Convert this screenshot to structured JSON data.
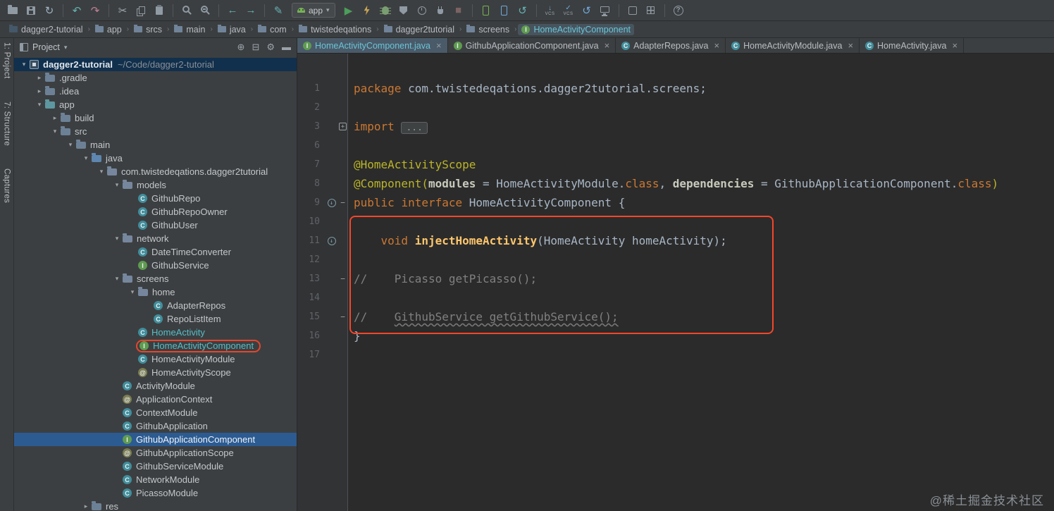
{
  "icons": {
    "chevron_down": "▾",
    "chevron_right": "▸",
    "chevron_sep": "›",
    "close": "×",
    "plus": "+",
    "minus": "−",
    "arrow_down": "↓",
    "check": "✓",
    "vcs_label": "VCS",
    "class_letter": "C",
    "interface_letter": "I",
    "annotation_char": "@",
    "help": "?"
  },
  "colors": {
    "highlight_red": "#f5462a",
    "selection_blue": "#2c5b92",
    "accent_teal": "#57bdc6",
    "keyword_orange": "#cc7832",
    "annotation_yellow": "#bbb529",
    "comment_gray": "#808080",
    "editor_bg": "#2b2b2b",
    "panel_bg": "#3c3f41"
  },
  "toolbar": {
    "items": [
      {
        "name": "open-project-icon",
        "css": "i-folder"
      },
      {
        "name": "save-all-icon",
        "css": "i-save"
      },
      {
        "name": "sync-icon",
        "glyph": "↻",
        "color": "#9fb3c4"
      },
      {
        "sep": true
      },
      {
        "name": "undo-icon",
        "glyph": "↶",
        "color": "#64b1b4"
      },
      {
        "name": "redo-icon",
        "glyph": "↷",
        "color": "#bd8193"
      },
      {
        "sep": true
      },
      {
        "name": "cut-icon",
        "glyph": "✂",
        "color": "#9fa9b1"
      },
      {
        "name": "copy-icon",
        "css": "i-copy"
      },
      {
        "name": "paste-icon",
        "css": "i-paste"
      },
      {
        "sep": true
      },
      {
        "name": "find-icon",
        "css": "i-search"
      },
      {
        "name": "replace-icon",
        "css": "i-replace"
      },
      {
        "sep": true
      },
      {
        "name": "back-icon",
        "glyph": "←",
        "color": "#64b1b4"
      },
      {
        "name": "forward-icon",
        "glyph": "→",
        "color": "#64b1b4"
      },
      {
        "sep": true
      },
      {
        "name": "edit-pencil-icon",
        "glyph": "✎",
        "color": "#64b1b4"
      },
      {
        "runconfig": true,
        "name": "run-config-select",
        "label": "app"
      },
      {
        "name": "run-icon",
        "glyph": "▶",
        "color": "#4c9e5a"
      },
      {
        "name": "apply-changes-icon",
        "css": "i-bolt"
      },
      {
        "name": "debug-icon",
        "css": "i-bug"
      },
      {
        "name": "coverage-icon",
        "css": "i-shield"
      },
      {
        "name": "profile-icon",
        "css": "i-clock"
      },
      {
        "name": "attach-debugger-icon",
        "css": "i-plug"
      },
      {
        "name": "stop-icon",
        "glyph": "■",
        "color": "#7b6263"
      },
      {
        "sep": true
      },
      {
        "name": "android-device-monitor-icon",
        "css": "i-phone"
      },
      {
        "name": "avd-manager-icon",
        "css": "i-phone-blue"
      },
      {
        "name": "gradle-sync-icon",
        "glyph": "↺",
        "color": "#64b1b4"
      },
      {
        "sep": true
      },
      {
        "name": "vcs-update-icon",
        "vcs": "down"
      },
      {
        "name": "vcs-commit-icon",
        "vcs": "check"
      },
      {
        "name": "revert-icon",
        "glyph": "↺",
        "color": "#6fa8dc"
      },
      {
        "name": "console-icon",
        "css": "i-monitor"
      },
      {
        "sep": true
      },
      {
        "name": "sdk-manager-icon",
        "css": "i-download"
      },
      {
        "name": "layout-inspector-icon",
        "css": "i-grid"
      },
      {
        "sep": true
      },
      {
        "name": "help-icon",
        "css": "i-help",
        "glyph": "?"
      }
    ]
  },
  "navbar": {
    "items": [
      {
        "ic": "project",
        "label": "dagger2-tutorial"
      },
      {
        "ic": "folder",
        "label": "app"
      },
      {
        "ic": "folder",
        "label": "srcs"
      },
      {
        "ic": "folder",
        "label": "main"
      },
      {
        "ic": "folder",
        "label": "java"
      },
      {
        "ic": "folder",
        "label": "com"
      },
      {
        "ic": "folder",
        "label": "twistedeqations"
      },
      {
        "ic": "folder",
        "label": "dagger2tutorial"
      },
      {
        "ic": "folder",
        "label": "screens"
      },
      {
        "ic": "interface",
        "label": "HomeActivityComponent",
        "active": true
      }
    ]
  },
  "left_stripe": {
    "items": [
      "1: Project",
      "7: Structure",
      "Captures"
    ]
  },
  "project_panel": {
    "title": "Project",
    "header_icons": [
      {
        "name": "scroll-to-source-icon",
        "glyph": "⊕"
      },
      {
        "name": "collapse-all-icon",
        "glyph": "⊟"
      },
      {
        "name": "settings-gear-icon",
        "glyph": "⚙"
      },
      {
        "name": "hide-panel-icon",
        "glyph": "▬"
      }
    ]
  },
  "tree": {
    "rows": [
      {
        "lv": 0,
        "ar": "v",
        "ic": "project",
        "label": "dagger2-tutorial",
        "path": "~/Code/dagger2-tutorial",
        "cls": "proj"
      },
      {
        "lv": 1,
        "ar": ">",
        "ic": "folder",
        "label": ".gradle"
      },
      {
        "lv": 1,
        "ar": ">",
        "ic": "folder",
        "label": ".idea"
      },
      {
        "lv": 1,
        "ar": "v",
        "ic": "module",
        "label": "app"
      },
      {
        "lv": 2,
        "ar": ">",
        "ic": "folder",
        "label": "build"
      },
      {
        "lv": 2,
        "ar": "v",
        "ic": "folder",
        "label": "src"
      },
      {
        "lv": 3,
        "ar": "v",
        "ic": "folder",
        "label": "main"
      },
      {
        "lv": 4,
        "ar": "v",
        "ic": "java",
        "label": "java"
      },
      {
        "lv": 5,
        "ar": "v",
        "ic": "package",
        "label": "com.twistedeqations.dagger2tutorial"
      },
      {
        "lv": 6,
        "ar": "v",
        "ic": "package",
        "label": "models"
      },
      {
        "lv": 7,
        "ic": "class",
        "label": "GithubRepo"
      },
      {
        "lv": 7,
        "ic": "class",
        "label": "GithubRepoOwner"
      },
      {
        "lv": 7,
        "ic": "class",
        "label": "GithubUser"
      },
      {
        "lv": 6,
        "ar": "v",
        "ic": "package",
        "label": "network"
      },
      {
        "lv": 7,
        "ic": "class",
        "label": "DateTimeConverter"
      },
      {
        "lv": 7,
        "ic": "interface",
        "label": "GithubService"
      },
      {
        "lv": 6,
        "ar": "v",
        "ic": "package",
        "label": "screens"
      },
      {
        "lv": 7,
        "ar": "v",
        "ic": "package",
        "label": "home"
      },
      {
        "lv": 8,
        "ic": "class",
        "label": "AdapterRepos"
      },
      {
        "lv": 8,
        "ic": "class",
        "label": "RepoListItem"
      },
      {
        "lv": 7,
        "ic": "class",
        "label": "HomeActivity",
        "accent": true
      },
      {
        "lv": 7,
        "ic": "interface",
        "label": "HomeActivityComponent",
        "accent": true,
        "outlined": true
      },
      {
        "lv": 7,
        "ic": "class",
        "label": "HomeActivityModule"
      },
      {
        "lv": 7,
        "ic": "annotation",
        "label": "HomeActivityScope"
      },
      {
        "lv": 6,
        "ic": "class",
        "label": "ActivityModule"
      },
      {
        "lv": 6,
        "ic": "annotation",
        "label": "ApplicationContext"
      },
      {
        "lv": 6,
        "ic": "class",
        "label": "ContextModule"
      },
      {
        "lv": 6,
        "ic": "class",
        "label": "GithubApplication"
      },
      {
        "lv": 6,
        "ic": "interface",
        "label": "GithubApplicationComponent",
        "selected": true
      },
      {
        "lv": 6,
        "ic": "annotation",
        "label": "GithubApplicationScope"
      },
      {
        "lv": 6,
        "ic": "class",
        "label": "GithubServiceModule"
      },
      {
        "lv": 6,
        "ic": "class",
        "label": "NetworkModule"
      },
      {
        "lv": 6,
        "ic": "class",
        "label": "PicassoModule"
      },
      {
        "lv": 4,
        "ar": ">",
        "ic": "folder",
        "label": "res"
      }
    ]
  },
  "editor": {
    "tabs": [
      {
        "ic": "interface",
        "label": "HomeActivityComponent.java",
        "active": true
      },
      {
        "ic": "interface",
        "label": "GithubApplicationComponent.java"
      },
      {
        "ic": "class",
        "label": "AdapterRepos.java"
      },
      {
        "ic": "class",
        "label": "HomeActivityModule.java"
      },
      {
        "ic": "class",
        "label": "HomeActivity.java"
      }
    ],
    "code": {
      "lines": [
        {
          "n": "1",
          "tk": [
            [
              "kw",
              "package"
            ],
            [
              "pl",
              " com.twistedeqations.dagger2tutorial.screens;"
            ]
          ]
        },
        {
          "n": "2",
          "tk": []
        },
        {
          "n": "3",
          "fold": "plus",
          "tk": [
            [
              "kw",
              "import"
            ],
            [
              "pl",
              " "
            ],
            [
              "chip",
              "..."
            ]
          ]
        },
        {
          "n": "6",
          "tk": []
        },
        {
          "n": "7",
          "tk": [
            [
              "ann",
              "@HomeActivityScope"
            ]
          ]
        },
        {
          "n": "8",
          "tk": [
            [
              "ann",
              "@Component("
            ],
            [
              "attr",
              "modules"
            ],
            [
              "pl",
              " = HomeActivityModule."
            ],
            [
              "kw",
              "class"
            ],
            [
              "pl",
              ", "
            ],
            [
              "attr",
              "dependencies"
            ],
            [
              "pl",
              " = GithubApplicationComponent."
            ],
            [
              "kw",
              "class"
            ],
            [
              "ann",
              ")"
            ]
          ]
        },
        {
          "n": "9",
          "fold": "minus",
          "gut": true,
          "tk": [
            [
              "kw",
              "public"
            ],
            [
              "pl",
              " "
            ],
            [
              "kw",
              "interface"
            ],
            [
              "pl",
              " HomeActivityComponent {"
            ]
          ]
        },
        {
          "n": "10",
          "tk": []
        },
        {
          "n": "11",
          "gut": true,
          "tk": [
            [
              "pl",
              "    "
            ],
            [
              "kw",
              "void"
            ],
            [
              "pl",
              " "
            ],
            [
              "me",
              "injectHomeActivity"
            ],
            [
              "pl",
              "(HomeActivity homeActivity);"
            ]
          ]
        },
        {
          "n": "12",
          "tk": []
        },
        {
          "n": "13",
          "fold": "minus",
          "tk": [
            [
              "cm",
              "//    Picasso getPicasso();"
            ]
          ]
        },
        {
          "n": "14",
          "tk": []
        },
        {
          "n": "15",
          "fold": "minus",
          "tk": [
            [
              "cm",
              "//    "
            ],
            [
              "cmu",
              "GithubService getGithubService();"
            ]
          ]
        },
        {
          "n": "16",
          "tk": [
            [
              "pl",
              "}"
            ]
          ]
        },
        {
          "n": "17",
          "tk": []
        }
      ]
    }
  },
  "watermark": "@稀土掘金技术社区"
}
